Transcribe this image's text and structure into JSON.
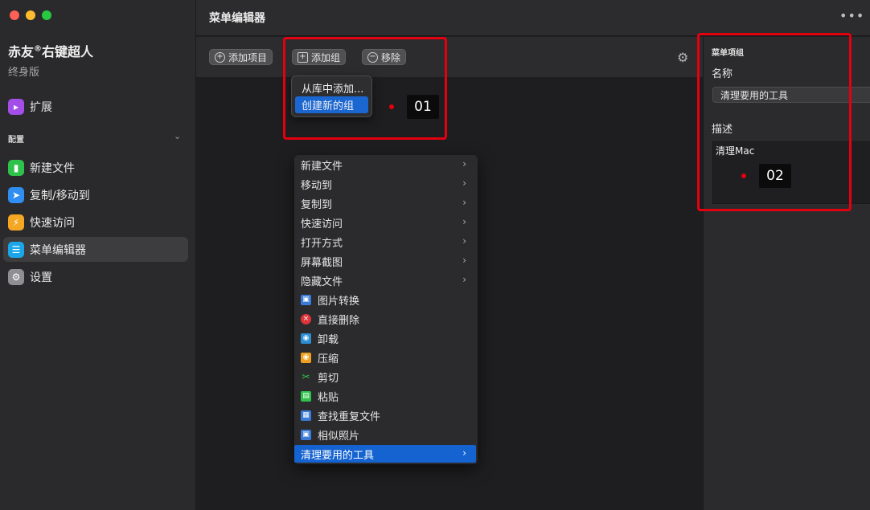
{
  "window": {
    "controls": [
      "close",
      "minimize",
      "zoom"
    ]
  },
  "sidebar": {
    "app_name": "赤友",
    "app_registered": "®",
    "app_name_rest": "右键超人",
    "edition": "终身版",
    "top_items": [
      {
        "label": "扩展",
        "icon": "extension-icon",
        "color": "#a34ee8"
      }
    ],
    "section_label": "配置",
    "items": [
      {
        "label": "新建文件",
        "icon": "new-file-icon",
        "color": "#2fc24a"
      },
      {
        "label": "复制/移动到",
        "icon": "send-icon",
        "color": "#2f8ef0"
      },
      {
        "label": "快速访问",
        "icon": "lightning-icon",
        "color": "#f5a623"
      },
      {
        "label": "菜单编辑器",
        "icon": "list-icon",
        "color": "#1aa6e8",
        "active": true
      },
      {
        "label": "设置",
        "icon": "gear-icon",
        "color": "#8e8e93"
      }
    ]
  },
  "header": {
    "title": "菜单编辑器",
    "more": "•••"
  },
  "toolbar": {
    "add_item": "添加项目",
    "add_group": "添加组",
    "remove": "移除"
  },
  "add_group_menu": {
    "items": [
      "从库中添加...",
      "创建新的组"
    ],
    "selected_index": 1
  },
  "context_menu": {
    "items": [
      {
        "label": "新建文件",
        "submenu": true
      },
      {
        "label": "移动到",
        "submenu": true
      },
      {
        "label": "复制到",
        "submenu": true
      },
      {
        "label": "快速访问",
        "submenu": true
      },
      {
        "label": "打开方式",
        "submenu": true
      },
      {
        "label": "屏幕截图",
        "submenu": true
      },
      {
        "label": "隐藏文件",
        "submenu": true
      },
      {
        "label": "图片转换",
        "icon": "image-convert-icon",
        "color": "#3b7bd8"
      },
      {
        "label": "直接删除",
        "icon": "delete-icon",
        "color": "#e0353a"
      },
      {
        "label": "卸载",
        "icon": "uninstall-icon",
        "color": "#2a8fd6"
      },
      {
        "label": "压缩",
        "icon": "compress-icon",
        "color": "#f0a020"
      },
      {
        "label": "剪切",
        "icon": "scissors-icon",
        "color": "#2fc24a"
      },
      {
        "label": "粘贴",
        "icon": "paste-icon",
        "color": "#2fc24a"
      },
      {
        "label": "查找重复文件",
        "icon": "duplicate-icon",
        "color": "#3b7bd8"
      },
      {
        "label": "相似照片",
        "icon": "photo-icon",
        "color": "#3b7bd8"
      },
      {
        "label": "清理要用的工具",
        "submenu": true,
        "selected": true
      }
    ]
  },
  "inspector": {
    "heading": "菜单项组",
    "name_label": "名称",
    "name_value": "清理要用的工具",
    "desc_label": "描述",
    "desc_value": "清理Mac"
  },
  "annotations": {
    "marker_1": "01",
    "marker_2": "02",
    "highlight_color": "#e3000f"
  }
}
